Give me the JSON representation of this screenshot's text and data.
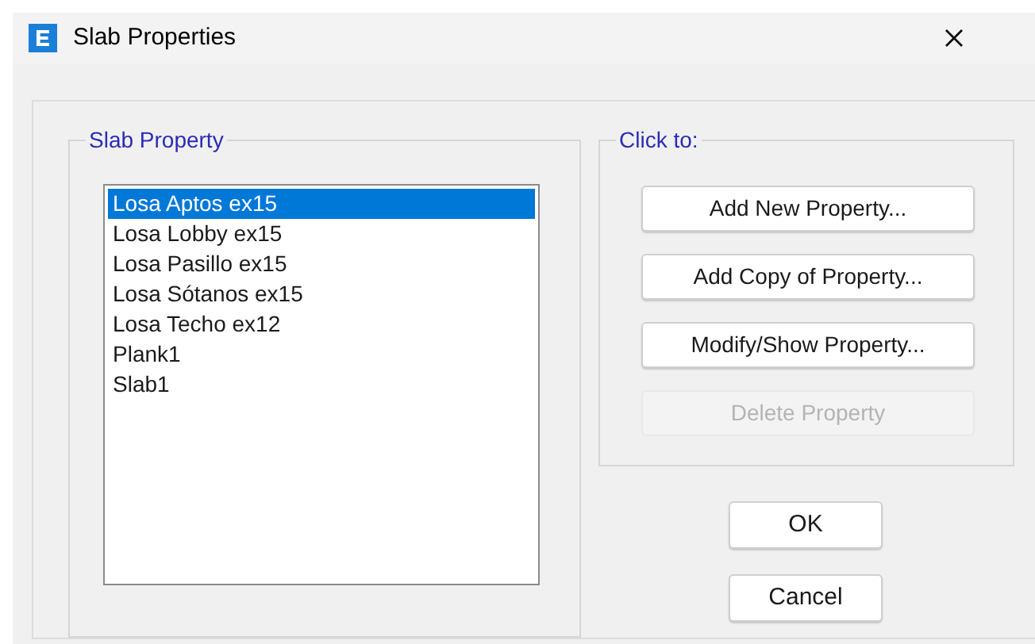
{
  "window": {
    "title": "Slab Properties"
  },
  "slab_property": {
    "title": "Slab Property",
    "items": [
      {
        "label": "Losa Aptos ex15",
        "selected": true
      },
      {
        "label": "Losa Lobby ex15",
        "selected": false
      },
      {
        "label": "Losa Pasillo ex15",
        "selected": false
      },
      {
        "label": "Losa Sótanos ex15",
        "selected": false
      },
      {
        "label": "Losa Techo ex12",
        "selected": false
      },
      {
        "label": "Plank1",
        "selected": false
      },
      {
        "label": "Slab1",
        "selected": false
      }
    ]
  },
  "click_to": {
    "title": "Click to:",
    "buttons": [
      {
        "label": "Add New Property...",
        "disabled": false
      },
      {
        "label": "Add Copy of Property...",
        "disabled": false
      },
      {
        "label": "Modify/Show Property...",
        "disabled": false
      },
      {
        "label": "Delete Property",
        "disabled": true
      }
    ]
  },
  "buttons": [
    "OK",
    "Cancel"
  ]
}
